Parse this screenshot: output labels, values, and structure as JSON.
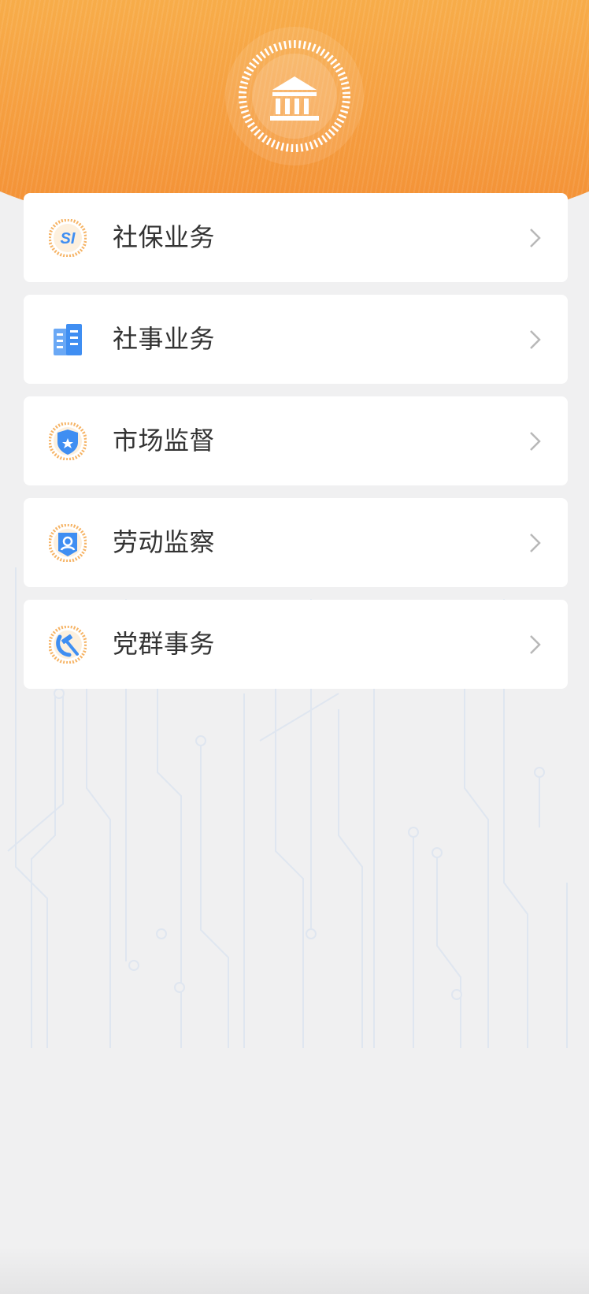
{
  "header": {
    "emblem_icon": "government-building-icon",
    "gradient": [
      "#f9c158",
      "#f38e34"
    ]
  },
  "menu": {
    "items": [
      {
        "label": "社保业务",
        "icon": "social-insurance-icon"
      },
      {
        "label": "社事业务",
        "icon": "office-building-icon"
      },
      {
        "label": "市场监督",
        "icon": "shield-star-icon"
      },
      {
        "label": "劳动监察",
        "icon": "person-badge-icon"
      },
      {
        "label": "党群事务",
        "icon": "hammer-sickle-icon"
      }
    ]
  },
  "colors": {
    "accent": "#f7aa48",
    "card_bg": "#ffffff",
    "page_bg": "#f0f0f1",
    "text": "#333333",
    "chevron": "#b8b8b8",
    "icon_blue": "#3f8ef2"
  }
}
